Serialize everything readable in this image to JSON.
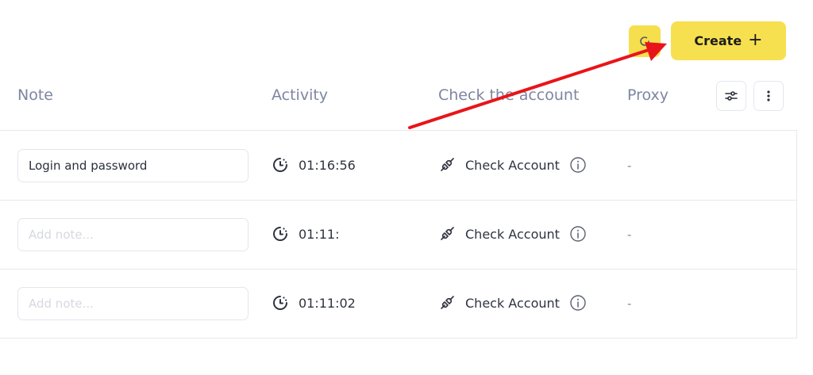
{
  "toolbar": {
    "create_label": "Create",
    "create_icon": "plus-icon",
    "refresh_icon": "refresh-icon"
  },
  "columns": {
    "note": "Note",
    "activity": "Activity",
    "check": "Check the account",
    "proxy": "Proxy"
  },
  "rows": [
    {
      "note_value": "Login and password",
      "note_placeholder": "Add note...",
      "activity": "01:16:56",
      "check_label": "Check Account",
      "proxy": "-"
    },
    {
      "note_value": "",
      "note_placeholder": "Add note...",
      "activity": "01:11:",
      "check_label": "Check Account",
      "proxy": "-"
    },
    {
      "note_value": "",
      "note_placeholder": "Add note...",
      "activity": "01:11:02",
      "check_label": "Check Account",
      "proxy": "-"
    }
  ],
  "colors": {
    "accent": "#f7e04f",
    "annotation_arrow": "#e8141a",
    "header_text": "#7d86a1"
  }
}
